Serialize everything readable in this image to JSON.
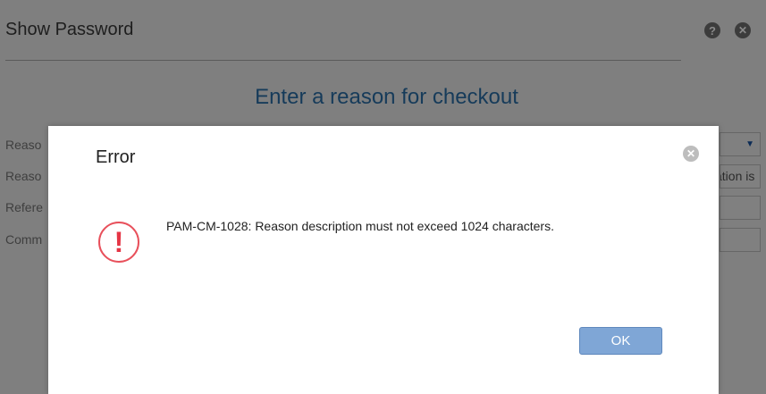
{
  "background_dialog": {
    "title": "Show Password",
    "help_icon": "question-icon",
    "close_icon": "close-icon",
    "heading": "Enter a reason for checkout",
    "fields": [
      {
        "label": "Reaso",
        "value": "▼"
      },
      {
        "label": "Reaso",
        "value": "ation is"
      },
      {
        "label": "Refere",
        "value": ""
      },
      {
        "label": "Comm",
        "value": ""
      }
    ]
  },
  "error_dialog": {
    "title": "Error",
    "close_icon": "close-circle-icon",
    "icon": "exclamation-icon",
    "icon_glyph": "!",
    "message": "PAM-CM-1028: Reason description must not exceed 1024 characters.",
    "ok_label": "OK"
  },
  "colors": {
    "overlay": "#7f7f7f",
    "heading": "#163b5a",
    "error_red": "#e53545",
    "ok_button": "#7fa6d6"
  }
}
